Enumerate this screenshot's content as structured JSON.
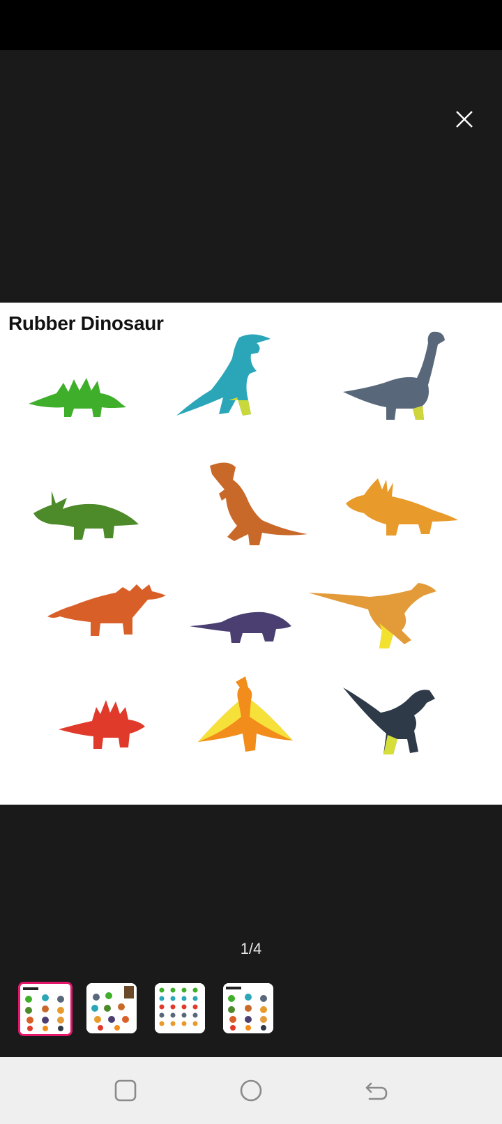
{
  "viewer": {
    "close_icon": "close-icon",
    "image_title": "Rubber Dinosaur",
    "counter": "1/4",
    "current_index": 1,
    "total": 4
  },
  "thumbnails": [
    {
      "index": 1,
      "selected": true
    },
    {
      "index": 2,
      "selected": false
    },
    {
      "index": 3,
      "selected": false
    },
    {
      "index": 4,
      "selected": false
    }
  ],
  "nav": {
    "recents_icon": "square-icon",
    "home_icon": "circle-icon",
    "back_icon": "back-arrow-icon"
  },
  "colors": {
    "background": "#1a1a1b",
    "thumbnail_selected_border": "#e5176a",
    "nav_background": "#efefef"
  }
}
